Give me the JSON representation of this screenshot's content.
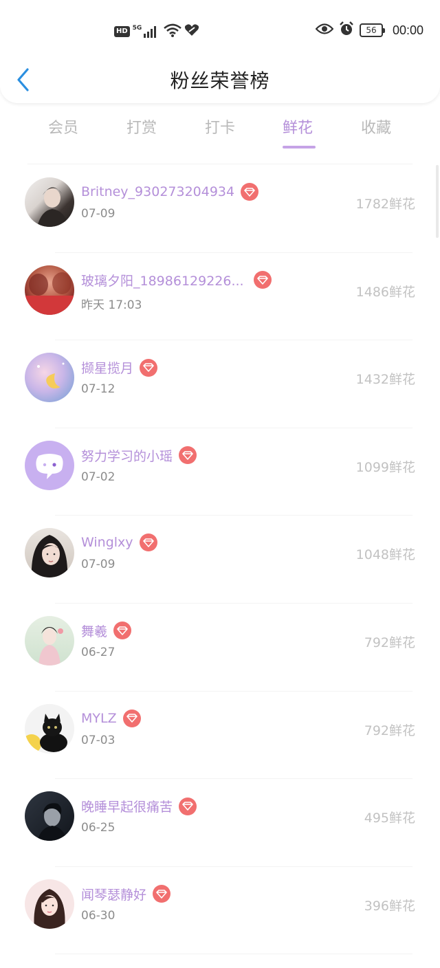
{
  "status_bar": {
    "hd_label": "HD",
    "network_label": "5G",
    "battery": "56",
    "time": "00:00"
  },
  "header": {
    "title": "粉丝荣誉榜"
  },
  "tabs": [
    {
      "label": "会员"
    },
    {
      "label": "打赏"
    },
    {
      "label": "打卡"
    },
    {
      "label": "鲜花"
    },
    {
      "label": "收藏"
    }
  ],
  "active_tab": "鲜花",
  "colors": {
    "accent": "#b48fd9",
    "badge": "#f16f6f",
    "count_text": "#c2c2c2",
    "back_arrow": "#2b8fe0"
  },
  "fans": [
    {
      "name": "Britney_930273204934",
      "date": "07-09",
      "count": "1782鲜花"
    },
    {
      "name": "玻璃夕阳_18986129226...",
      "date": "昨天 17:03",
      "count": "1486鲜花"
    },
    {
      "name": "撷星揽月",
      "date": "07-12",
      "count": "1432鲜花"
    },
    {
      "name": "努力学习的小瑶",
      "date": "07-02",
      "count": "1099鲜花"
    },
    {
      "name": "Winglxy",
      "date": "07-09",
      "count": "1048鲜花"
    },
    {
      "name": "舞羲",
      "date": "06-27",
      "count": "792鲜花"
    },
    {
      "name": "MYLZ",
      "date": "07-03",
      "count": "792鲜花"
    },
    {
      "name": "晚睡早起很痛苦",
      "date": "06-25",
      "count": "495鲜花"
    },
    {
      "name": "闻琴瑟静好",
      "date": "06-30",
      "count": "396鲜花"
    }
  ]
}
